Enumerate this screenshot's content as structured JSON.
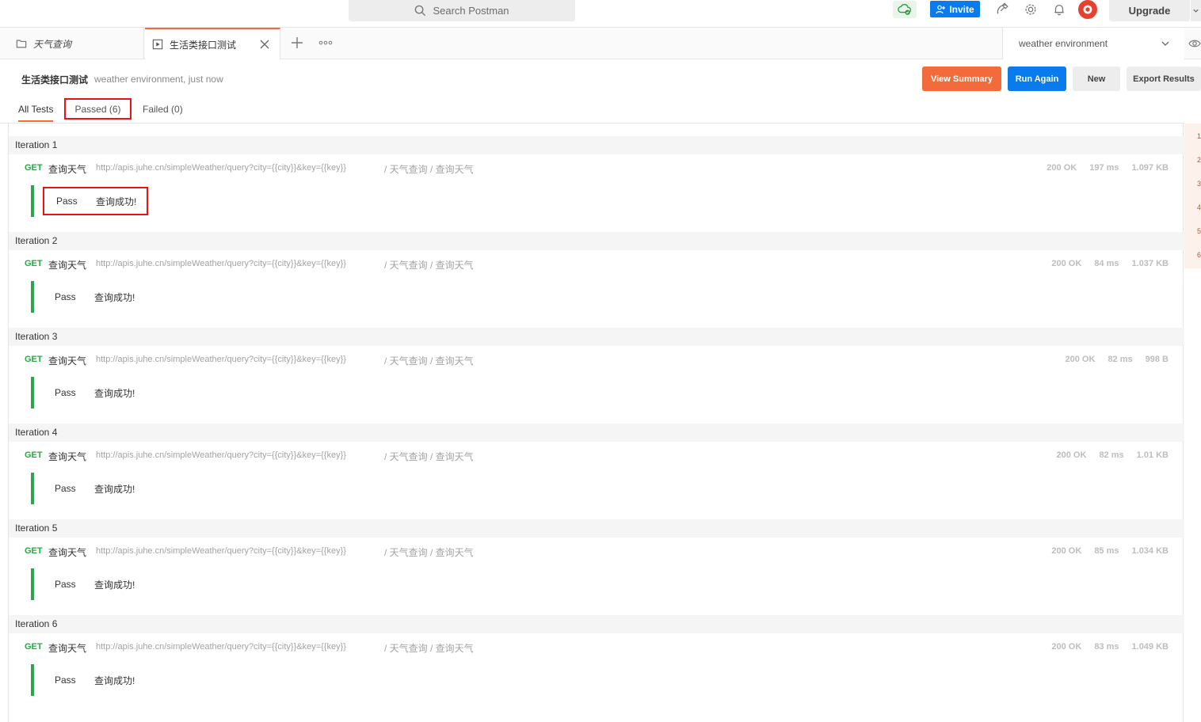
{
  "header": {
    "search_placeholder": "Search Postman",
    "invite_label": "Invite",
    "upgrade_label": "Upgrade"
  },
  "tabs": [
    {
      "label": "天气查询"
    },
    {
      "label": "生活类接口测试"
    }
  ],
  "environment": {
    "selected": "weather environment"
  },
  "run": {
    "title": "生活类接口测试",
    "subtitle": "weather environment, just now",
    "buttons": {
      "view_summary": "View Summary",
      "run_again": "Run Again",
      "new": "New",
      "export": "Export Results"
    }
  },
  "filters": {
    "all": "All Tests",
    "passed": "Passed (6)",
    "failed": "Failed (0)"
  },
  "gutter_numbers": [
    "1",
    "2",
    "3",
    "4",
    "5",
    "6"
  ],
  "iterations": [
    {
      "label": "Iteration 1",
      "method": "GET",
      "name": "查询天气",
      "url": "http://apis.juhe.cn/simpleWeather/query?city={{city}}&key={{key}}",
      "path": "/ 天气查询 / 查询天气",
      "status": "200 OK",
      "time": "197 ms",
      "size": "1.097 KB",
      "result": "Pass",
      "message": "查询成功!"
    },
    {
      "label": "Iteration 2",
      "method": "GET",
      "name": "查询天气",
      "url": "http://apis.juhe.cn/simpleWeather/query?city={{city}}&key={{key}}",
      "path": "/ 天气查询 / 查询天气",
      "status": "200 OK",
      "time": "84 ms",
      "size": "1.037 KB",
      "result": "Pass",
      "message": "查询成功!"
    },
    {
      "label": "Iteration 3",
      "method": "GET",
      "name": "查询天气",
      "url": "http://apis.juhe.cn/simpleWeather/query?city={{city}}&key={{key}}",
      "path": "/ 天气查询 / 查询天气",
      "status": "200 OK",
      "time": "82 ms",
      "size": "998 B",
      "result": "Pass",
      "message": "查询成功!"
    },
    {
      "label": "Iteration 4",
      "method": "GET",
      "name": "查询天气",
      "url": "http://apis.juhe.cn/simpleWeather/query?city={{city}}&key={{key}}",
      "path": "/ 天气查询 / 查询天气",
      "status": "200 OK",
      "time": "82 ms",
      "size": "1.01 KB",
      "result": "Pass",
      "message": "查询成功!"
    },
    {
      "label": "Iteration 5",
      "method": "GET",
      "name": "查询天气",
      "url": "http://apis.juhe.cn/simpleWeather/query?city={{city}}&key={{key}}",
      "path": "/ 天气查询 / 查询天气",
      "status": "200 OK",
      "time": "85 ms",
      "size": "1.034 KB",
      "result": "Pass",
      "message": "查询成功!"
    },
    {
      "label": "Iteration 6",
      "method": "GET",
      "name": "查询天气",
      "url": "http://apis.juhe.cn/simpleWeather/query?city={{city}}&key={{key}}",
      "path": "/ 天气查询 / 查询天气",
      "status": "200 OK",
      "time": "83 ms",
      "size": "1.049 KB",
      "result": "Pass",
      "message": "查询成功!"
    }
  ],
  "colors": {
    "accent": "#f26b3a",
    "primary": "#097bed",
    "pass": "#2ea44f",
    "highlight": "#e11111"
  }
}
